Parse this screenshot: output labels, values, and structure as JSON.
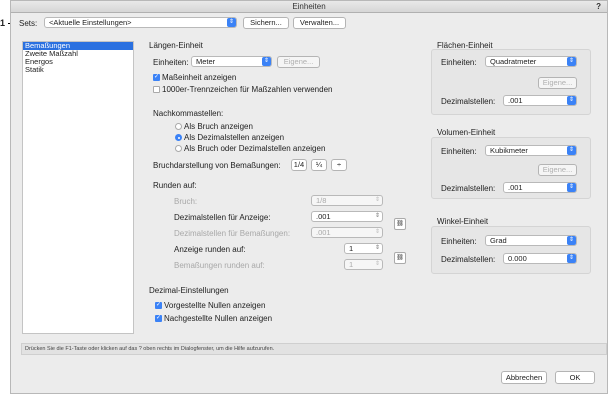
{
  "window": {
    "title": "Einheiten",
    "help": "?"
  },
  "callout": "1",
  "sets": {
    "label": "Sets:",
    "value": "<Aktuelle Einstellungen>",
    "save": "Sichern...",
    "manage": "Verwalten..."
  },
  "sidebar": {
    "items": [
      "Bemaßungen",
      "Zweite Maßzahl",
      "Energos",
      "Statik"
    ]
  },
  "laengen": {
    "title": "Längen-Einheit",
    "einheiten_label": "Einheiten:",
    "einheiten_value": "Meter",
    "eigene": "Eigene...",
    "cb_masseinheit": "Maßeinheit anzeigen",
    "cb_trennzeichen": "1000er-Trennzeichen für Maßzahlen verwenden",
    "nachkomma": "Nachkommastellen:",
    "radio_bruch": "Als Bruch anzeigen",
    "radio_dezimal": "Als Dezimalstellen anzeigen",
    "radio_beides": "Als Bruch oder Dezimalstellen anzeigen",
    "bruchdarstellung": "Bruchdarstellung von Bemaßungen:",
    "frac1": "1/4",
    "frac2": "¼",
    "frac3": "÷",
    "runden": "Runden auf:",
    "bruch_label": "Bruch:",
    "bruch_value": "1/8",
    "dez_anzeige_label": "Dezimalstellen für Anzeige:",
    "dez_anzeige_value": ".001",
    "dez_bemassung_label": "Dezimalstellen für Bemaßungen:",
    "dez_bemassung_value": ".001",
    "anzeige_runden_label": "Anzeige runden auf:",
    "anzeige_runden_value": "1",
    "bemassung_runden_label": "Bemaßungen runden auf:",
    "bemassung_runden_value": "1"
  },
  "dezimal": {
    "title": "Dezimal-Einstellungen",
    "cb_vorgestellt": "Vorgestellte Nullen anzeigen",
    "cb_nachgestellt": "Nachgestellte Nullen anzeigen"
  },
  "flaechen": {
    "title": "Flächen-Einheit",
    "einheiten_label": "Einheiten:",
    "einheiten_value": "Quadratmeter",
    "eigene": "Eigene...",
    "dez_label": "Dezimalstellen:",
    "dez_value": ".001"
  },
  "volumen": {
    "title": "Volumen-Einheit",
    "einheiten_label": "Einheiten:",
    "einheiten_value": "Kubikmeter",
    "eigene": "Eigene...",
    "dez_label": "Dezimalstellen:",
    "dez_value": ".001"
  },
  "winkel": {
    "title": "Winkel-Einheit",
    "einheiten_label": "Einheiten:",
    "einheiten_value": "Grad",
    "dez_label": "Dezimalstellen:",
    "dez_value": "0.000"
  },
  "status": "Drücken Sie die F1-Taste oder klicken auf das ? oben rechts im Dialogfenster, um die Hilfe aufzurufen.",
  "buttons": {
    "cancel": "Abbrechen",
    "ok": "OK"
  },
  "colors": {
    "accent": "#3b82f6",
    "selection": "#2a70e0"
  }
}
